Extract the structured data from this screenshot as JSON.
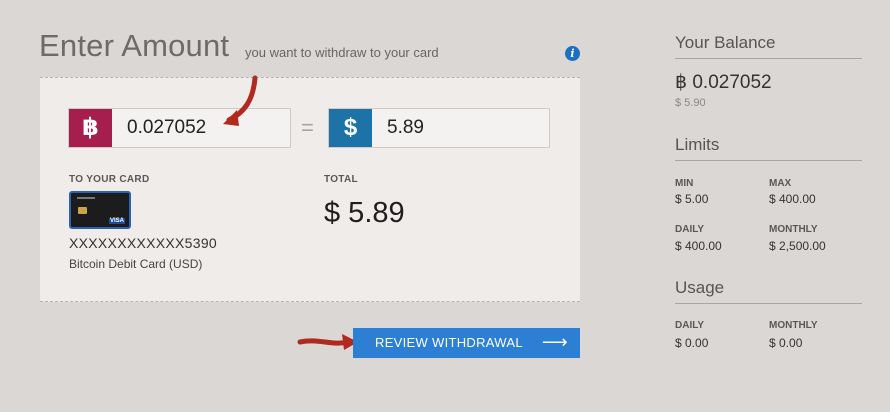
{
  "header": {
    "title": "Enter Amount",
    "subtitle": "you want to withdraw to your card",
    "info_icon": "i"
  },
  "amounts": {
    "btc_symbol": "฿",
    "btc_value": "0.027052",
    "equals": "=",
    "usd_symbol": "$",
    "usd_value": "5.89"
  },
  "card": {
    "label": "TO YOUR CARD",
    "number": "XXXXXXXXXXXX5390",
    "name": "Bitcoin Debit Card (USD)",
    "brand": "VISA"
  },
  "total": {
    "label": "TOTAL",
    "value": "$ 5.89"
  },
  "actions": {
    "review_label": "REVIEW WITHDRAWAL",
    "review_arrow": "⟶"
  },
  "sidebar": {
    "balance": {
      "heading": "Your Balance",
      "value": "฿ 0.027052",
      "sub": "$ 5.90"
    },
    "limits": {
      "heading": "Limits",
      "min_label": "MIN",
      "min_value": "$ 5.00",
      "max_label": "MAX",
      "max_value": "$ 400.00",
      "daily_label": "DAILY",
      "daily_value": "$ 400.00",
      "monthly_label": "MONTHLY",
      "monthly_value": "$ 2,500.00"
    },
    "usage": {
      "heading": "Usage",
      "daily_label": "DAILY",
      "daily_value": "$ 0.00",
      "monthly_label": "MONTHLY",
      "monthly_value": "$ 0.00"
    }
  },
  "colors": {
    "btc_badge": "#a61e4d",
    "usd_badge": "#1d73a8",
    "button": "#2c7fd3",
    "annotation": "#b22a1e"
  }
}
